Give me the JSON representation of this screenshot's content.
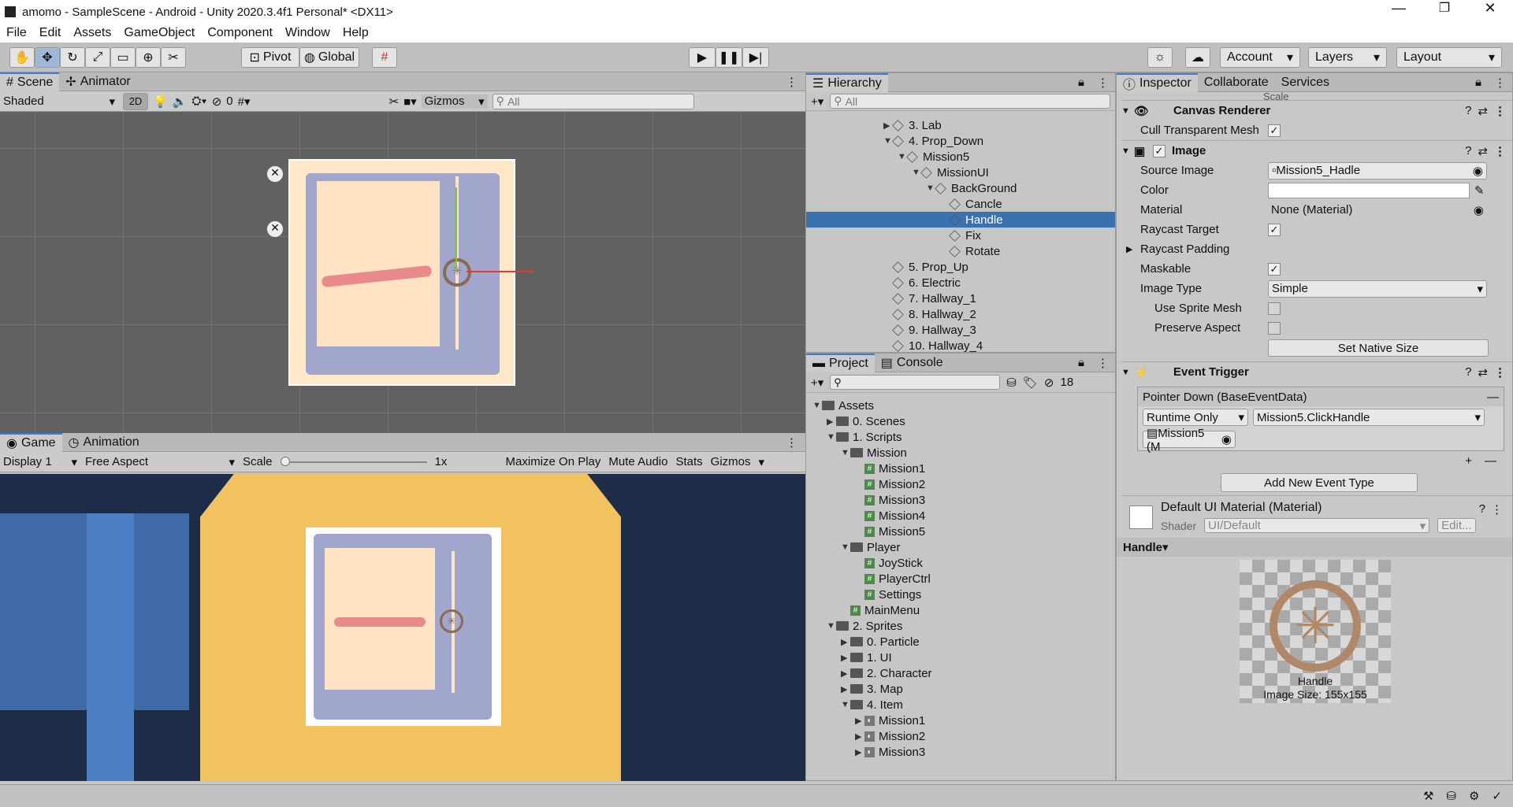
{
  "window": {
    "title": "amomo - SampleScene - Android - Unity 2020.3.4f1 Personal* <DX11>"
  },
  "menu": [
    "File",
    "Edit",
    "Assets",
    "GameObject",
    "Component",
    "Window",
    "Help"
  ],
  "toolbar": {
    "pivot": "Pivot",
    "global": "Global",
    "account": "Account",
    "layers": "Layers",
    "layout": "Layout"
  },
  "scene": {
    "tab_scene": "Scene",
    "tab_animator": "Animator",
    "shading": "Shaded",
    "mode2d": "2D",
    "hidden_count": "0",
    "gizmos": "Gizmos",
    "search_placeholder": "All"
  },
  "game": {
    "tab_game": "Game",
    "tab_animation": "Animation",
    "display": "Display 1",
    "aspect": "Free Aspect",
    "scale_label": "Scale",
    "scale_value": "1x",
    "maximize": "Maximize On Play",
    "mute": "Mute Audio",
    "stats": "Stats",
    "gizmos": "Gizmos"
  },
  "hierarchy": {
    "tab": "Hierarchy",
    "search_placeholder": "All",
    "items": [
      {
        "label": "3. Lab",
        "indent": 0,
        "arrow": "▶"
      },
      {
        "label": "4. Prop_Down",
        "indent": 0,
        "arrow": "▼"
      },
      {
        "label": "Mission5",
        "indent": 1,
        "arrow": "▼"
      },
      {
        "label": "MissionUI",
        "indent": 2,
        "arrow": "▼"
      },
      {
        "label": "BackGround",
        "indent": 3,
        "arrow": "▼"
      },
      {
        "label": "Cancle",
        "indent": 4,
        "arrow": ""
      },
      {
        "label": "Handle",
        "indent": 4,
        "arrow": "",
        "selected": true
      },
      {
        "label": "Fix",
        "indent": 4,
        "arrow": ""
      },
      {
        "label": "Rotate",
        "indent": 4,
        "arrow": ""
      },
      {
        "label": "5. Prop_Up",
        "indent": 0,
        "arrow": ""
      },
      {
        "label": "6. Electric",
        "indent": 0,
        "arrow": ""
      },
      {
        "label": "7. Hallway_1",
        "indent": 0,
        "arrow": ""
      },
      {
        "label": "8. Hallway_2",
        "indent": 0,
        "arrow": ""
      },
      {
        "label": "9. Hallway_3",
        "indent": 0,
        "arrow": ""
      },
      {
        "label": "10. Hallway_4",
        "indent": 0,
        "arrow": ""
      }
    ]
  },
  "project": {
    "tab_project": "Project",
    "tab_console": "Console",
    "hidden_count": "18",
    "items": [
      {
        "label": "Assets",
        "indent": 0,
        "arrow": "▼",
        "kind": "folder"
      },
      {
        "label": "0. Scenes",
        "indent": 1,
        "arrow": "▶",
        "kind": "folder"
      },
      {
        "label": "1. Scripts",
        "indent": 1,
        "arrow": "▼",
        "kind": "folder"
      },
      {
        "label": "Mission",
        "indent": 2,
        "arrow": "▼",
        "kind": "folder"
      },
      {
        "label": "Mission1",
        "indent": 3,
        "arrow": "",
        "kind": "script"
      },
      {
        "label": "Mission2",
        "indent": 3,
        "arrow": "",
        "kind": "script"
      },
      {
        "label": "Mission3",
        "indent": 3,
        "arrow": "",
        "kind": "script"
      },
      {
        "label": "Mission4",
        "indent": 3,
        "arrow": "",
        "kind": "script"
      },
      {
        "label": "Mission5",
        "indent": 3,
        "arrow": "",
        "kind": "script"
      },
      {
        "label": "Player",
        "indent": 2,
        "arrow": "▼",
        "kind": "folder"
      },
      {
        "label": "JoyStick",
        "indent": 3,
        "arrow": "",
        "kind": "script"
      },
      {
        "label": "PlayerCtrl",
        "indent": 3,
        "arrow": "",
        "kind": "script"
      },
      {
        "label": "Settings",
        "indent": 3,
        "arrow": "",
        "kind": "script"
      },
      {
        "label": "MainMenu",
        "indent": 2,
        "arrow": "",
        "kind": "script"
      },
      {
        "label": "2. Sprites",
        "indent": 1,
        "arrow": "▼",
        "kind": "folder"
      },
      {
        "label": "0. Particle",
        "indent": 2,
        "arrow": "▶",
        "kind": "folder"
      },
      {
        "label": "1. UI",
        "indent": 2,
        "arrow": "▶",
        "kind": "folder"
      },
      {
        "label": "2. Character",
        "indent": 2,
        "arrow": "▶",
        "kind": "folder"
      },
      {
        "label": "3. Map",
        "indent": 2,
        "arrow": "▶",
        "kind": "folder"
      },
      {
        "label": "4. Item",
        "indent": 2,
        "arrow": "▼",
        "kind": "folder"
      },
      {
        "label": "Mission1",
        "indent": 3,
        "arrow": "▶",
        "kind": "sprite"
      },
      {
        "label": "Mission2",
        "indent": 3,
        "arrow": "▶",
        "kind": "sprite"
      },
      {
        "label": "Mission3",
        "indent": 3,
        "arrow": "▶",
        "kind": "sprite"
      }
    ]
  },
  "inspector": {
    "tab_inspector": "Inspector",
    "tab_collaborate": "Collaborate",
    "tab_services": "Services",
    "scale_label": "Scale",
    "canvas_renderer": "Canvas Renderer",
    "cull_label": "Cull Transparent Mesh",
    "image": "Image",
    "source_image_label": "Source Image",
    "source_image_value": "Mission5_Hadle",
    "color_label": "Color",
    "material_label": "Material",
    "material_value": "None (Material)",
    "raycast_target": "Raycast Target",
    "raycast_padding": "Raycast Padding",
    "maskable": "Maskable",
    "image_type_label": "Image Type",
    "image_type_value": "Simple",
    "use_sprite_mesh": "Use Sprite Mesh",
    "preserve_aspect": "Preserve Aspect",
    "set_native_size": "Set Native Size",
    "event_trigger": "Event Trigger",
    "pointer_down": "Pointer Down (BaseEventData)",
    "runtime_only": "Runtime Only",
    "function": "Mission5.ClickHandle",
    "object_ref": "Mission5 (M",
    "add_event": "Add New Event Type",
    "material_name": "Default UI Material (Material)",
    "shader_label": "Shader",
    "shader_value": "UI/Default",
    "edit": "Edit...",
    "preview_label": "Handle",
    "preview_name": "Handle",
    "preview_size": "Image Size: 155x155"
  }
}
